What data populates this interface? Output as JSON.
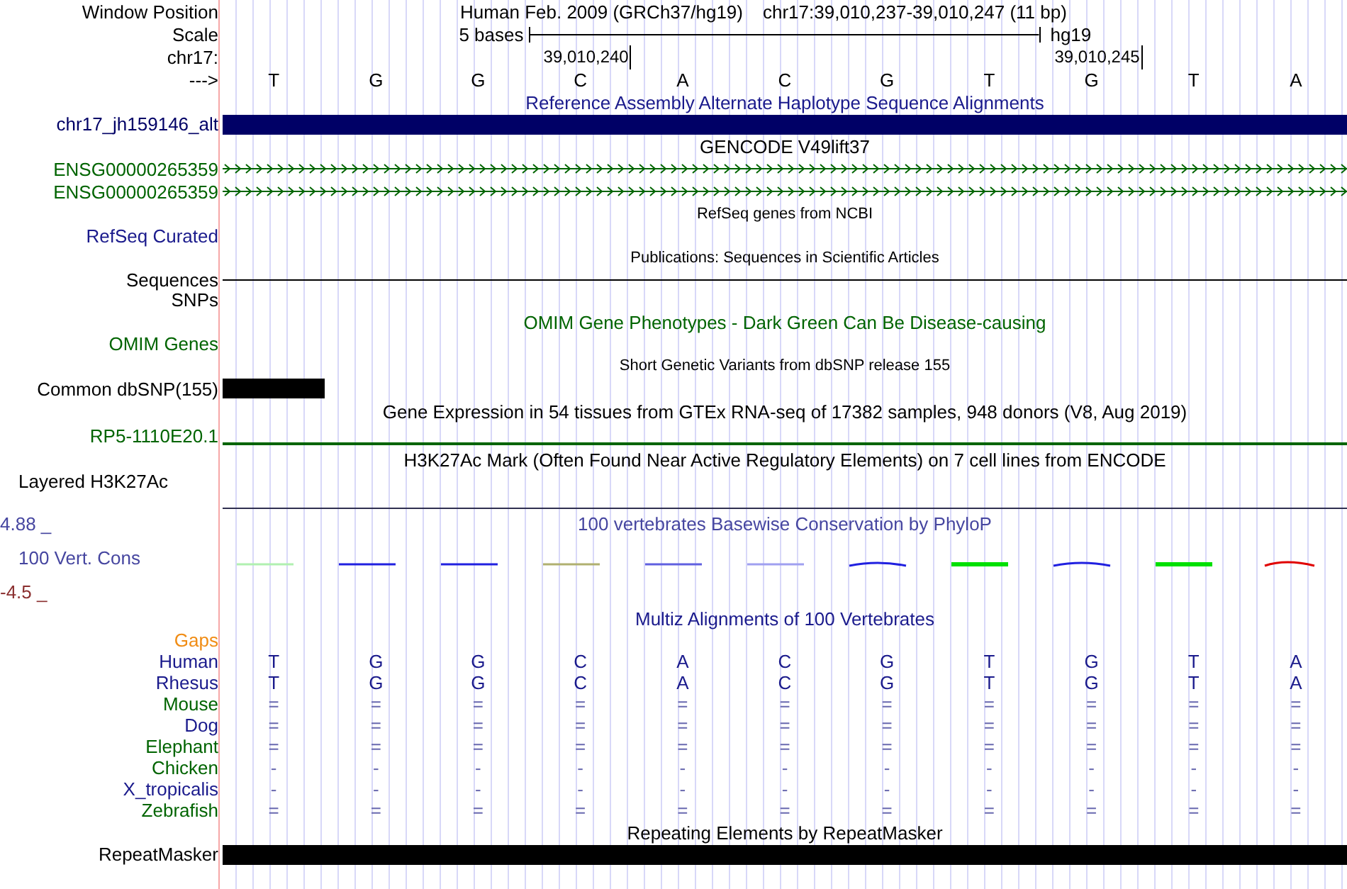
{
  "position": {
    "label": "Window Position",
    "assembly": "Human Feb. 2009 (GRCh37/hg19)",
    "range": "chr17:39,010,237-39,010,247 (11 bp)"
  },
  "scale": {
    "label": "Scale",
    "bar_label": "5 bases",
    "db": "hg19"
  },
  "coordinates": {
    "label": "chr17:",
    "ticks": [
      "39,010,240",
      "39,010,245"
    ]
  },
  "bases": {
    "label": "--->",
    "letters": [
      "T",
      "G",
      "G",
      "C",
      "A",
      "C",
      "G",
      "T",
      "G",
      "T",
      "A"
    ]
  },
  "tracks": [
    {
      "kind": "title",
      "text": "Reference Assembly Alternate Haplotype Sequence Alignments",
      "color": "#1a1a8c"
    },
    {
      "kind": "bar",
      "label": "chr17_jh159146_alt",
      "color": "#000066"
    },
    {
      "kind": "title",
      "text": "GENCODE V49lift37",
      "color": "#000000"
    },
    {
      "kind": "gene",
      "label": "ENSG00000265359",
      "color": "#006400"
    },
    {
      "kind": "gene",
      "label": "ENSG00000265359",
      "color": "#006400"
    },
    {
      "kind": "subtitle",
      "text": "RefSeq genes from NCBI",
      "color": "#000000"
    },
    {
      "kind": "empty",
      "label": "RefSeq Curated",
      "color": "#1a1a8c"
    },
    {
      "kind": "subtitle",
      "text": "Publications: Sequences in Scientific Articles",
      "color": "#000000"
    },
    {
      "kind": "line",
      "label": "Sequences",
      "color": "#000000"
    },
    {
      "kind": "empty",
      "label": "SNPs",
      "color": "#000000"
    },
    {
      "kind": "title",
      "text": "OMIM Gene Phenotypes - Dark Green Can Be Disease-causing",
      "color": "#006400"
    },
    {
      "kind": "empty",
      "label": "OMIM Genes",
      "color": "#006400"
    },
    {
      "kind": "subtitle",
      "text": "Short Genetic Variants from dbSNP release 155",
      "color": "#000000"
    },
    {
      "kind": "snp",
      "label": "Common dbSNP(155)",
      "color": "#000000"
    },
    {
      "kind": "title",
      "text": "Gene Expression in 54 tissues from GTEx RNA-seq of 17382 samples, 948 donors (V8, Aug 2019)",
      "color": "#000000"
    },
    {
      "kind": "gtex",
      "label": "RP5-1110E20.1",
      "color": "#006400"
    },
    {
      "kind": "title",
      "text": "H3K27Ac Mark (Often Found Near Active Regulatory Elements) on 7 cell lines from ENCODE",
      "color": "#000000"
    },
    {
      "kind": "layered",
      "label": "Layered H3K27Ac",
      "color": "#000000"
    },
    {
      "kind": "wiggle",
      "label": "100 Vert. Cons",
      "max": "4.88 _",
      "min": "-4.5 _",
      "text": "100 vertebrates Basewise Conservation by PhyloP",
      "color": "#4646a0"
    },
    {
      "kind": "title",
      "text": "Multiz Alignments of 100 Vertebrates",
      "color": "#1a1a8c"
    },
    {
      "kind": "empty",
      "label": "Gaps",
      "color": "#f08c14"
    },
    {
      "kind": "align",
      "label": "Human",
      "color": "#1a1a8c",
      "letters": [
        "T",
        "G",
        "G",
        "C",
        "A",
        "C",
        "G",
        "T",
        "G",
        "T",
        "A"
      ]
    },
    {
      "kind": "align",
      "label": "Rhesus",
      "color": "#1a1a8c",
      "letters": [
        "T",
        "G",
        "G",
        "C",
        "A",
        "C",
        "G",
        "T",
        "G",
        "T",
        "A"
      ]
    },
    {
      "kind": "align",
      "label": "Mouse",
      "color": "#006400",
      "letters": [
        "=",
        "=",
        "=",
        "=",
        "=",
        "=",
        "=",
        "=",
        "=",
        "=",
        "="
      ]
    },
    {
      "kind": "align",
      "label": "Dog",
      "color": "#1a1a8c",
      "letters": [
        "=",
        "=",
        "=",
        "=",
        "=",
        "=",
        "=",
        "=",
        "=",
        "=",
        "="
      ]
    },
    {
      "kind": "align",
      "label": "Elephant",
      "color": "#006400",
      "letters": [
        "=",
        "=",
        "=",
        "=",
        "=",
        "=",
        "=",
        "=",
        "=",
        "=",
        "="
      ]
    },
    {
      "kind": "align",
      "label": "Chicken",
      "color": "#006400",
      "letters": [
        "-",
        "-",
        "-",
        "-",
        "-",
        "-",
        "-",
        "-",
        "-",
        "-",
        "-"
      ]
    },
    {
      "kind": "align",
      "label": "X_tropicalis",
      "color": "#1a1a8c",
      "letters": [
        "-",
        "-",
        "-",
        "-",
        "-",
        "-",
        "-",
        "-",
        "-",
        "-",
        "-"
      ]
    },
    {
      "kind": "align",
      "label": "Zebrafish",
      "color": "#006400",
      "letters": [
        "=",
        "=",
        "=",
        "=",
        "=",
        "=",
        "=",
        "=",
        "=",
        "=",
        "="
      ]
    },
    {
      "kind": "title",
      "text": "Repeating Elements by RepeatMasker",
      "color": "#000000"
    },
    {
      "kind": "bar",
      "label": "RepeatMasker",
      "color": "#000000"
    }
  ]
}
